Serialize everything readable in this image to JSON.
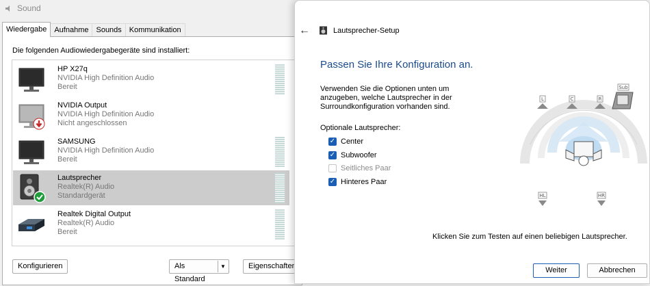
{
  "sound": {
    "title": "Sound",
    "tabs": [
      "Wiedergabe",
      "Aufnahme",
      "Sounds",
      "Kommunikation"
    ],
    "installed_label": "Die folgenden Audiowiedergabegeräte sind installiert:",
    "devices": [
      {
        "name": "HP X27q",
        "driver": "NVIDIA High Definition Audio",
        "status": "Bereit",
        "icon": "monitor-icon"
      },
      {
        "name": "NVIDIA Output",
        "driver": "NVIDIA High Definition Audio",
        "status": "Nicht angeschlossen",
        "icon": "monitor-disconnected-icon"
      },
      {
        "name": "SAMSUNG",
        "driver": "NVIDIA High Definition Audio",
        "status": "Bereit",
        "icon": "monitor-icon"
      },
      {
        "name": "Lautsprecher",
        "driver": "Realtek(R) Audio",
        "status": "Standardgerät",
        "icon": "speaker-default-icon",
        "selected": true
      },
      {
        "name": "Realtek Digital Output",
        "driver": "Realtek(R) Audio",
        "status": "Bereit",
        "icon": "digital-output-icon"
      }
    ],
    "buttons": {
      "configure": "Konfigurieren",
      "set_default": "Als Standard",
      "properties": "Eigenschaften"
    }
  },
  "setup": {
    "title": "Lautsprecher-Setup",
    "heading": "Passen Sie Ihre Konfiguration an.",
    "description": "Verwenden Sie die Optionen unten um anzugeben, welche Lautsprecher in der Surroundkonfiguration vorhanden sind.",
    "optional_label": "Optionale Lautsprecher:",
    "options": [
      {
        "label": "Center",
        "checked": true,
        "enabled": true
      },
      {
        "label": "Subwoofer",
        "checked": true,
        "enabled": true
      },
      {
        "label": "Seitliches Paar",
        "checked": false,
        "enabled": false
      },
      {
        "label": "Hinteres Paar",
        "checked": true,
        "enabled": true
      }
    ],
    "speaker_labels": {
      "left": "L",
      "center": "C",
      "right": "R",
      "sub": "Sub",
      "rear_left": "HL",
      "rear_right": "HR"
    },
    "test_hint": "Klicken Sie zum Testen auf einen beliebigen Lautsprecher.",
    "buttons": {
      "next": "Weiter",
      "cancel": "Abbrechen"
    },
    "colors": {
      "heading": "#1a4a8c",
      "accent": "#1a5fb4"
    }
  }
}
